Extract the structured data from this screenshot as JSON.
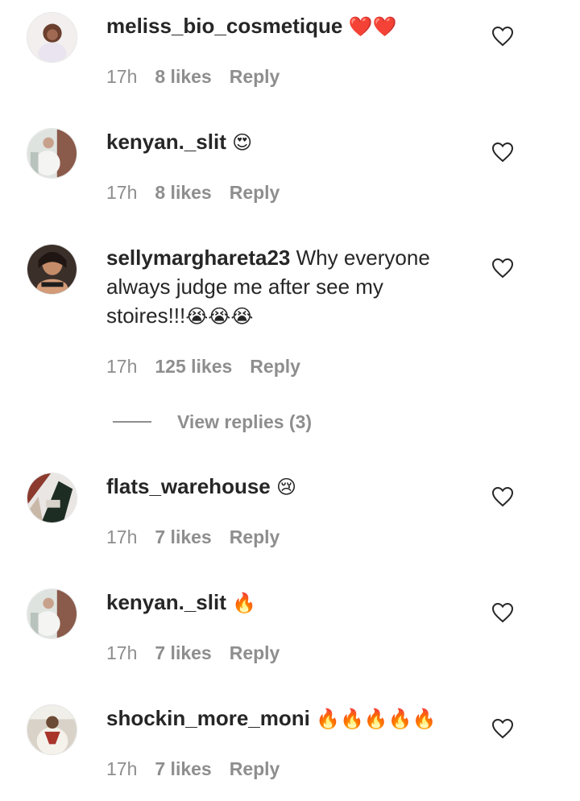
{
  "comments": [
    {
      "username": "meliss_bio_cosmetique",
      "text": "",
      "emoji": "❤️❤️",
      "time": "17h",
      "likes": "8 likes",
      "reply": "Reply"
    },
    {
      "username": "kenyan._slit",
      "text": "",
      "emoji": "😍",
      "time": "17h",
      "likes": "8 likes",
      "reply": "Reply"
    },
    {
      "username": "sellymarghareta23",
      "text": " Why everyone always judge me after see my stoires!!!",
      "emoji": "😭😭😭",
      "time": "17h",
      "likes": "125 likes",
      "reply": "Reply",
      "view_replies": "View replies (3)"
    },
    {
      "username": "flats_warehouse",
      "text": "",
      "emoji": "😢",
      "time": "17h",
      "likes": "7 likes",
      "reply": "Reply"
    },
    {
      "username": "kenyan._slit",
      "text": "",
      "emoji": "🔥",
      "time": "17h",
      "likes": "7 likes",
      "reply": "Reply"
    },
    {
      "username": "shockin_more_moni",
      "text": "",
      "emoji": "🔥🔥🔥🔥🔥",
      "time": "17h",
      "likes": "7 likes",
      "reply": "Reply"
    }
  ],
  "icons": {
    "like": "heart-outline-icon"
  },
  "colors": {
    "text": "#262626",
    "secondary": "#8e8e8e"
  }
}
